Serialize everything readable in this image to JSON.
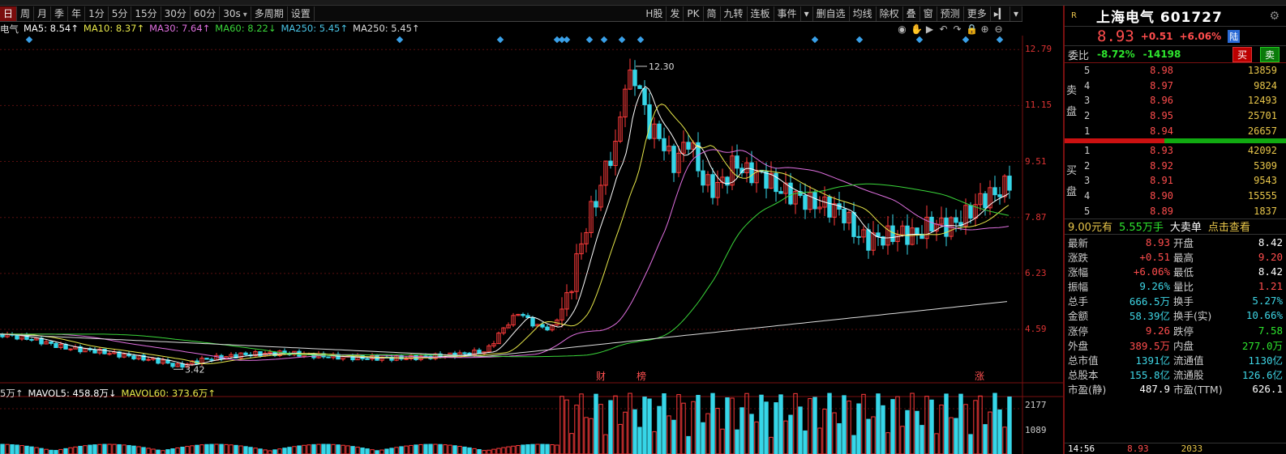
{
  "toolbar": {
    "periods": [
      "日",
      "周",
      "月",
      "季",
      "年",
      "1分",
      "5分",
      "15分",
      "30分",
      "60分"
    ],
    "active_period": "日",
    "interval": "30s",
    "multi_period": "多周期",
    "settings": "设置",
    "right_items": [
      "H股",
      "发",
      "PK",
      "简",
      "九转",
      "连板",
      "事件"
    ],
    "right_items2": [
      "删自选",
      "均线",
      "除权",
      "叠",
      "窗",
      "预测",
      "更多"
    ]
  },
  "ma_legend": [
    {
      "text": "电气",
      "color": "#dddddd"
    },
    {
      "text": "MA5: 8.54↑",
      "color": "#ffffff"
    },
    {
      "text": "MA10: 8.37↑",
      "color": "#e8e84a"
    },
    {
      "text": "MA30: 7.64↑",
      "color": "#e070e0"
    },
    {
      "text": "MA60: 8.22↓",
      "color": "#3ad63a"
    },
    {
      "text": "MA250: 5.45↑",
      "color": "#4ac6e8"
    },
    {
      "text": "MA250: 5.45↑",
      "color": "#dddddd"
    }
  ],
  "chart_tools": [
    "eye-icon",
    "pan-icon",
    "play-icon",
    "undo-icon",
    "redo-icon",
    "lock-icon",
    "zoom-in-icon",
    "zoom-out-icon"
  ],
  "price_axis": [
    "12.79",
    "11.15",
    "9.51",
    "7.87",
    "6.23",
    "4.59"
  ],
  "volume_axis": [
    "2177",
    "1089"
  ],
  "annotations": {
    "high": "12.30",
    "low": "3.42",
    "event1": "财",
    "event2": "榜",
    "event3": "涨"
  },
  "vol_legend": [
    {
      "text": "5万↑",
      "color": "#dddddd"
    },
    {
      "text": "MAVOL5: 458.8万↓",
      "color": "#ffffff"
    },
    {
      "text": "MAVOL60: 373.6万↑",
      "color": "#e8e84a"
    }
  ],
  "chart_data": {
    "type": "candlestick",
    "ylim": [
      3.0,
      13.2
    ],
    "price_ticks": [
      12.79,
      11.15,
      9.51,
      7.87,
      6.23,
      4.59
    ],
    "high": 12.3,
    "low": 3.42,
    "last_close": 8.93,
    "ma_last": {
      "MA5": 8.54,
      "MA10": 8.37,
      "MA30": 7.64,
      "MA60": 8.22,
      "MA250": 5.45
    },
    "volume_ticks": [
      2177,
      1089
    ]
  },
  "panel": {
    "name": "上海电气 601727",
    "price": "8.93",
    "change": "+0.51",
    "change_pct": "+6.06%",
    "badge": "陆",
    "weibi_label": "委比",
    "weibi_pct": "-8.72%",
    "weibi_diff": "-14198",
    "buy_btn": "买",
    "sell_btn": "卖",
    "sell_label": "卖盘",
    "buy_label": "买盘",
    "asks": [
      {
        "lv": "5",
        "price": "8.98",
        "vol": "13859"
      },
      {
        "lv": "4",
        "price": "8.97",
        "vol": "9824"
      },
      {
        "lv": "3",
        "price": "8.96",
        "vol": "12493"
      },
      {
        "lv": "2",
        "price": "8.95",
        "vol": "25701"
      },
      {
        "lv": "1",
        "price": "8.94",
        "vol": "26657"
      }
    ],
    "bids": [
      {
        "lv": "1",
        "price": "8.93",
        "vol": "42092"
      },
      {
        "lv": "2",
        "price": "8.92",
        "vol": "5309"
      },
      {
        "lv": "3",
        "price": "8.91",
        "vol": "9543"
      },
      {
        "lv": "4",
        "price": "8.90",
        "vol": "15555"
      },
      {
        "lv": "5",
        "price": "8.89",
        "vol": "1837"
      }
    ],
    "ticker": {
      "a": "9.00元有",
      "b": "5.55万手",
      "c": "大卖单",
      "d": "点击查看"
    },
    "stats": [
      {
        "k": "最新",
        "v1": "8.93",
        "k2": "开盘",
        "v2": "8.42",
        "c1": "",
        "c2": "white"
      },
      {
        "k": "涨跌",
        "v1": "+0.51",
        "k2": "最高",
        "v2": "9.20",
        "c1": "",
        "c2": ""
      },
      {
        "k": "涨幅",
        "v1": "+6.06%",
        "k2": "最低",
        "v2": "8.42",
        "c1": "",
        "c2": "white"
      },
      {
        "k": "振幅",
        "v1": "9.26%",
        "k2": "量比",
        "v2": "1.21",
        "c1": "cyan",
        "c2": ""
      },
      {
        "k": "总手",
        "v1": "666.5万",
        "k2": "换手",
        "v2": "5.27%",
        "c1": "cyan",
        "c2": "cyan"
      },
      {
        "k": "金额",
        "v1": "58.39亿",
        "k2": "换手(实)",
        "v2": "10.66%",
        "c1": "cyan",
        "c2": "cyan"
      },
      {
        "k": "涨停",
        "v1": "9.26",
        "k2": "跌停",
        "v2": "7.58",
        "c1": "",
        "c2": "green"
      },
      {
        "k": "外盘",
        "v1": "389.5万",
        "k2": "内盘",
        "v2": "277.0万",
        "c1": "",
        "c2": "green"
      },
      {
        "k": "总市值",
        "v1": "1391亿",
        "k2": "流通值",
        "v2": "1130亿",
        "c1": "cyan",
        "c2": "cyan"
      },
      {
        "k": "总股本",
        "v1": "155.8亿",
        "k2": "流通股",
        "v2": "126.6亿",
        "c1": "cyan",
        "c2": "cyan"
      },
      {
        "k": "市盈(静)",
        "v1": "487.9",
        "k2": "市盈(TTM)",
        "v2": "626.1",
        "c1": "white",
        "c2": "white"
      }
    ],
    "bottom": {
      "time": "14:56",
      "price": "8.93",
      "vol": "2033"
    }
  }
}
